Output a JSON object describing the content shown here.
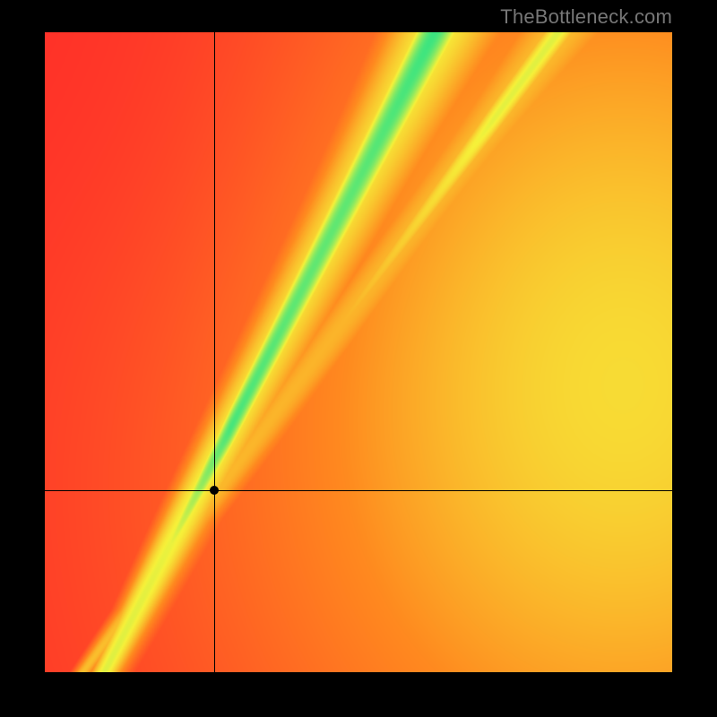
{
  "watermark": "TheBottleneck.com",
  "chart_data": {
    "type": "heatmap",
    "title": "",
    "xlabel": "",
    "ylabel": "",
    "xlim": [
      0,
      1
    ],
    "ylim": [
      0,
      1
    ],
    "crosshair": {
      "x": 0.27,
      "y": 0.285
    },
    "point": {
      "x": 0.27,
      "y": 0.285
    },
    "ridges": [
      {
        "slope": 1.9,
        "intercept": -0.18,
        "width": 0.07
      },
      {
        "slope": 1.32,
        "intercept": -0.08,
        "width": 0.025
      }
    ],
    "palette": {
      "red": "#ff2a2a",
      "orange": "#ff8a1f",
      "yellow": "#f6f23a",
      "green": "#16e28f"
    },
    "grid": false,
    "legend": false,
    "note": "Heatmap is a continuous field; no discrete data points beyond the single marked crosshair."
  }
}
